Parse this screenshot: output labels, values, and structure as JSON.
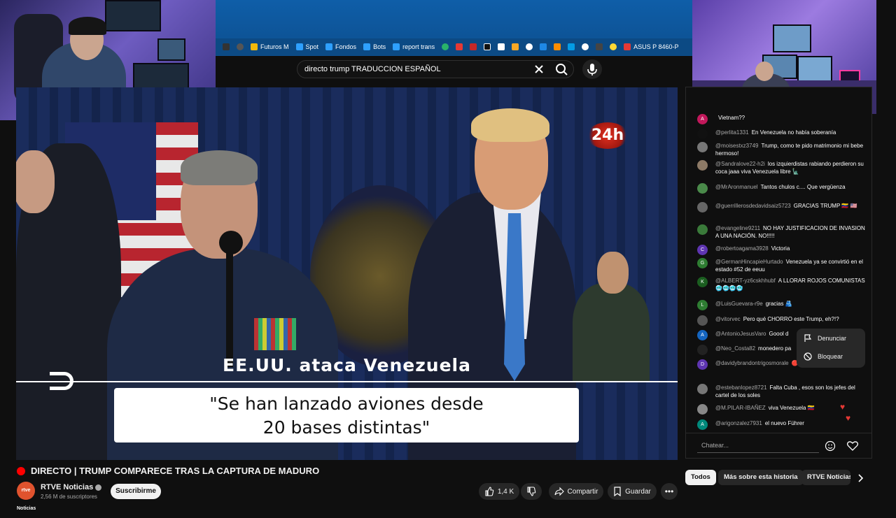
{
  "browser": {
    "bookmarks": [
      {
        "label": "Futuros M",
        "icon": "futures-icon",
        "color": "#f0b90b"
      },
      {
        "label": "Spot",
        "icon": "spot-icon",
        "color": "#2ea0ff"
      },
      {
        "label": "Fondos",
        "icon": "funds-icon",
        "color": "#2ea0ff"
      },
      {
        "label": "Bots",
        "icon": "bots-icon",
        "color": "#2ea0ff"
      },
      {
        "label": "report trans",
        "icon": "report-icon",
        "color": "#2ea0ff"
      },
      {
        "label": "ASUS P 8460-P",
        "icon": "asus-icon",
        "color": "#e53935"
      }
    ]
  },
  "search": {
    "query": "directo trump TRADUCCION ESPAÑOL"
  },
  "video": {
    "channel_badge": "24h",
    "lower_third_headline": "EE.UU. ataca Venezuela",
    "quote_line1": "\"Se han lanzado aviones desde",
    "quote_line2": "20 bases distintas\""
  },
  "watch": {
    "title": "DIRECTO | TRUMP COMPARECE TRAS LA CAPTURA DE MADURO",
    "channel_avatar_text": "rtve Noticias",
    "channel_name": "RTVE Noticias",
    "subscribers": "2,56 M de suscriptores",
    "subscribe_label": "Suscribirme",
    "likes": "1,4 K",
    "share_label": "Compartir",
    "save_label": "Guardar"
  },
  "chat": {
    "messages": [
      {
        "author": "",
        "text": "Vietnam??",
        "avatar": "A",
        "color": "#c2185b"
      },
      {
        "author": "@perlita1331",
        "text": "En Venezuela no había soberanía",
        "avatar": "",
        "color": "#111111"
      },
      {
        "author": "@moisestxz3749",
        "text": "Trump, como te pido matrimonio mi bebe hermoso!",
        "avatar": "",
        "color": "#777777"
      },
      {
        "author": "@Sandralove22-h2i",
        "text": "los izquierdistas rabiando perdieron su coca jaaa viva Venezuela libre 🗽",
        "avatar": "",
        "color": "#8d7a66"
      },
      {
        "author": "@MrAronmanuel",
        "text": "Tantos chulos c.... Que vergüenza",
        "avatar": "",
        "color": "#4a8a4a"
      },
      {
        "author": "@guerrillerosdedavidsaiz5723",
        "text": "GRACIAS TRUMP 🇻🇪 🇺🇸",
        "avatar": "",
        "color": "#666666"
      },
      {
        "author": "@evangeline9211",
        "text": "NO HAY JUSTIFICACION DE INVASION A UNA NACIÓN. NO!!!!!",
        "avatar": "",
        "color": "#3a7a3a"
      },
      {
        "author": "@robertoagama3928",
        "text": "Victoria",
        "avatar": "C",
        "color": "#5e35b1"
      },
      {
        "author": "@GermanHincapieHurtado",
        "text": "Venezuela ya se convirtió en el estado #52 de eeuu",
        "avatar": "G",
        "color": "#2e7d32"
      },
      {
        "author": "@ALBERT-yz6cskhhubf",
        "text": "A LLORAR ROJOS COMUNISTAS 🥶🥶🥶🥶",
        "avatar": "K",
        "color": "#1b5e20"
      },
      {
        "author": "@LuisGuevara-r9e",
        "text": "gracias 🫂",
        "avatar": "L",
        "color": "#2e7d32"
      },
      {
        "author": "@vitorvec",
        "text": "Pero qué CHORRO este Trump, eh?!?",
        "avatar": "",
        "color": "#555555"
      },
      {
        "author": "@AntonioJesusVaro",
        "text": "Goool d",
        "avatar": "A",
        "color": "#1565c0"
      },
      {
        "author": "@Neo_Costa82",
        "text": "monedero pa",
        "avatar": "",
        "color": "#222222"
      },
      {
        "author": "@davidybrandontrigosmorale",
        "text": "🔴",
        "avatar": "D",
        "color": "#5e35b1"
      },
      {
        "author": "@estebanlopez8721",
        "text": "Falta Cuba , esos son los jefes del cartel de los soles",
        "avatar": "",
        "color": "#777777"
      },
      {
        "author": "@M.PILAR-IBAÑEZ",
        "text": "viva Venezuela 🇻🇪",
        "avatar": "",
        "color": "#888888"
      },
      {
        "author": "@arigonzalez7931",
        "text": "el nuevo Führer",
        "avatar": "A",
        "color": "#00897b"
      }
    ],
    "menu": {
      "report_label": "Denunciar",
      "block_label": "Bloquear"
    },
    "input_placeholder": "Chatear..."
  },
  "chips": [
    "Todos",
    "Más sobre esta historia",
    "RTVE Noticias"
  ]
}
